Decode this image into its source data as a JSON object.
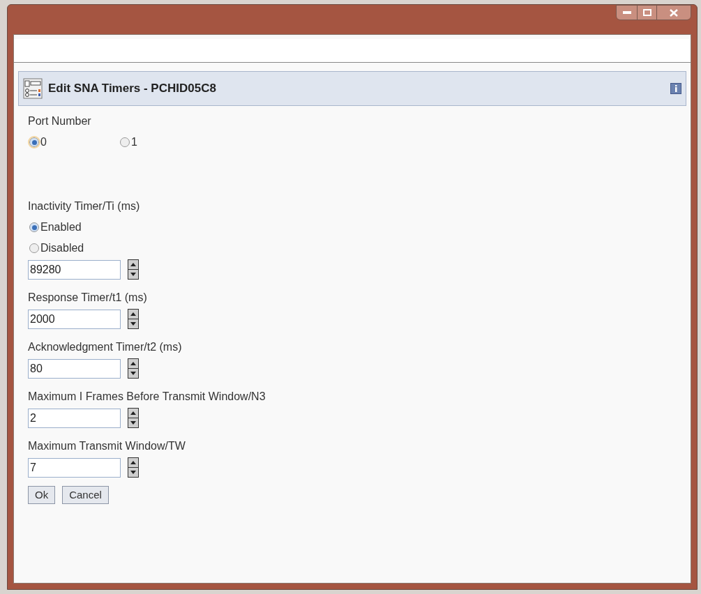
{
  "panel": {
    "title": "Edit SNA Timers - PCHID05C8"
  },
  "port": {
    "label": "Port Number",
    "options": [
      {
        "label": "0",
        "selected": true,
        "focused": true
      },
      {
        "label": "1",
        "selected": false,
        "focused": false
      }
    ]
  },
  "timers": [
    {
      "label": "Inactivity Timer/Ti (ms)",
      "options": [
        {
          "label": "Enabled",
          "selected": true
        },
        {
          "label": "Disabled",
          "selected": false
        }
      ],
      "spinner": {
        "value": "89280"
      }
    },
    {
      "label": "Response Timer/t1 (ms)",
      "spinner": {
        "value": "2000"
      }
    },
    {
      "label": "Acknowledgment Timer/t2 (ms)",
      "spinner": {
        "value": "80"
      }
    },
    {
      "label": "Maximum I Frames Before Transmit Window/N3",
      "spinner": {
        "value": "2"
      }
    },
    {
      "label": "Maximum Transmit Window/TW",
      "spinner": {
        "value": "7"
      }
    }
  ],
  "buttons": [
    "Ok",
    "Cancel"
  ]
}
